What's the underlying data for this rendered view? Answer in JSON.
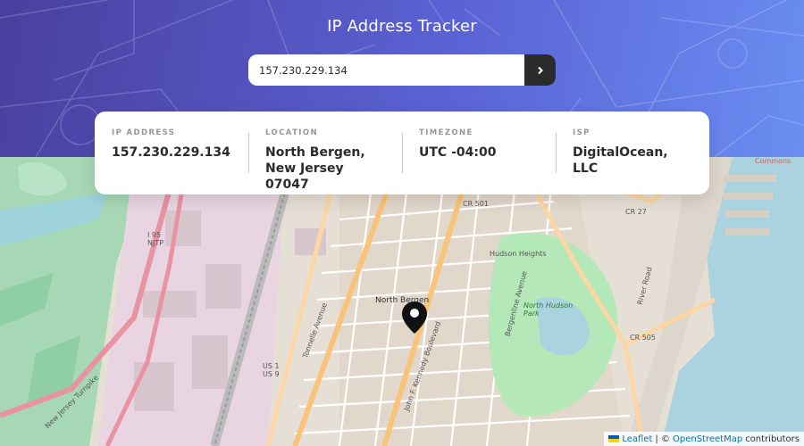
{
  "header": {
    "title": "IP Address Tracker"
  },
  "search": {
    "value": "157.230.229.134",
    "button_icon": "chevron-right-icon"
  },
  "info": [
    {
      "label": "IP ADDRESS",
      "value": "157.230.229.134"
    },
    {
      "label": "LOCATION",
      "value": "North Bergen, New Jersey 07047"
    },
    {
      "label": "TIMEZONE",
      "value": "UTC -04:00"
    },
    {
      "label": "ISP",
      "value": "DigitalOcean, LLC"
    }
  ],
  "map": {
    "labels": {
      "north_bergen": "North Bergen",
      "north_hudson_park": "North Hudson Park",
      "commons": "Commons",
      "cr501": "CR 501",
      "cr27": "CR 27",
      "cr505": "CR 505",
      "i95": "I 95 NJTP",
      "us1": "US 1 US 9",
      "nj_turnpike": "New Jersey Turnpike",
      "kennedy": "John F. Kennedy Boulevard",
      "tonnelle": "Tonnelle Avenue",
      "river_road": "River Road",
      "hudson_heights": "Hudson Heights",
      "bergenline": "Bergenline Avenue"
    },
    "attribution": {
      "leaflet": "Leaflet",
      "separator": "| ©",
      "osm": "OpenStreetMap",
      "suffix": "contributors"
    }
  },
  "colors": {
    "header_start": "#4a3f9e",
    "header_end": "#6a8ef2",
    "dark": "#2b2b2b",
    "muted": "#969696",
    "water": "#aad3df",
    "park": "#c8facc"
  }
}
